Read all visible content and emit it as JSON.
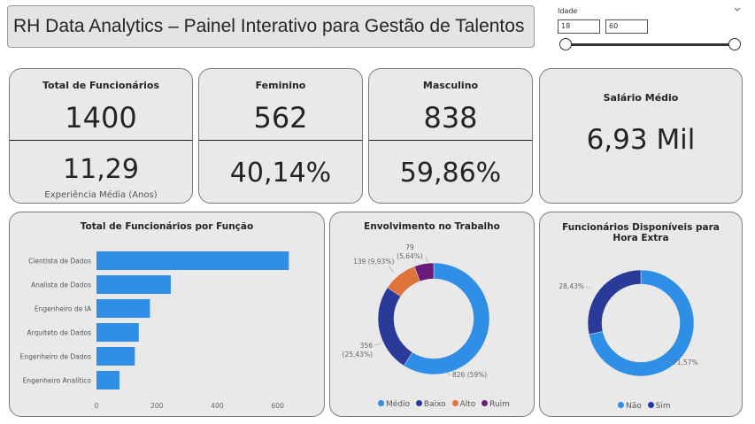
{
  "header": {
    "title": "RH Data Analytics – Painel Interativo para Gestão de Talentos"
  },
  "slicer": {
    "label": "Idade",
    "min_value": "18",
    "max_value": "60",
    "range": [
      18,
      60
    ]
  },
  "kpis": {
    "total": {
      "label": "Total de Funcionários",
      "value": "1400",
      "experience": "11,29",
      "experience_label": "Experiência Média (Anos)"
    },
    "female": {
      "label": "Feminino",
      "value": "562",
      "percent": "40,14%"
    },
    "male": {
      "label": "Masculino",
      "value": "838",
      "percent": "59,86%"
    },
    "salary": {
      "label": "Salário Médio",
      "value": "6,93 Mil"
    }
  },
  "colors": {
    "blue": "#2f8ee6",
    "navy": "#2a3a99",
    "orange": "#e0733a",
    "purple": "#6a1b7a"
  },
  "chart_data": [
    {
      "type": "bar",
      "title": "Total de Funcionários por Função",
      "categories": [
        "Cientista de Dados",
        "Analista de Dados",
        "Engenheiro de IA",
        "Arquiteto de Dados",
        "Engenheiro de Dados",
        "Engenheiro Analítico"
      ],
      "values": [
        637,
        246,
        177,
        140,
        127,
        76
      ],
      "xlim": [
        0,
        680
      ],
      "xticks": [
        "0",
        "200",
        "400",
        "600"
      ],
      "xtick_values": [
        0,
        200,
        400,
        600
      ],
      "orientation": "horizontal"
    },
    {
      "type": "pie",
      "title": "Envolvimento no Trabalho",
      "labels": [
        "Médio",
        "Baixo",
        "Alto",
        "Ruim"
      ],
      "values": [
        826,
        356,
        139,
        79
      ],
      "data_labels": [
        "826 (59%)",
        "356 (25,43%)",
        "139 (9,93%)",
        "79 (5,64%)"
      ],
      "legend": "bottom"
    },
    {
      "type": "pie",
      "title": "Funcionários Disponíveis para Hora Extra",
      "labels": [
        "Não",
        "Sim"
      ],
      "values": [
        71.57,
        28.43
      ],
      "data_labels": [
        "71,57%",
        "28,43%"
      ],
      "legend": "bottom"
    }
  ]
}
